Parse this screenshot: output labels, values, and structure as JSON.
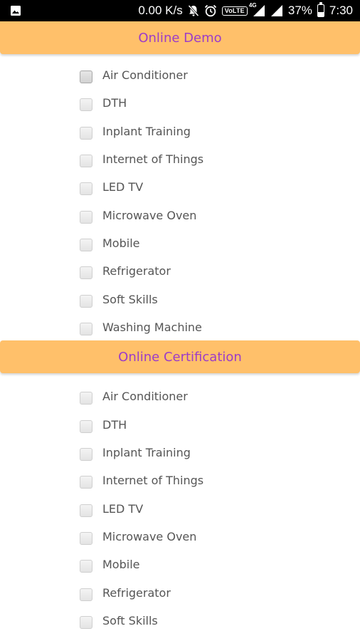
{
  "status_bar": {
    "network_speed": "0.00 K/s",
    "volte_label": "VoLTE",
    "network_type": "4G",
    "battery_percent": "37%",
    "battery_level": 0.37,
    "time": "7:30",
    "icons": [
      "image-icon",
      "mute-icon",
      "alarm-icon",
      "volte-icon",
      "signal-icon",
      "signal-icon",
      "battery-icon"
    ]
  },
  "sections": [
    {
      "title": "Online Demo",
      "items": [
        {
          "label": "Air Conditioner",
          "checked": false
        },
        {
          "label": "DTH",
          "checked": false
        },
        {
          "label": "Inplant Training",
          "checked": false
        },
        {
          "label": "Internet of Things",
          "checked": false
        },
        {
          "label": "LED TV",
          "checked": false
        },
        {
          "label": "Microwave Oven",
          "checked": false
        },
        {
          "label": "Mobile",
          "checked": false
        },
        {
          "label": "Refrigerator",
          "checked": false
        },
        {
          "label": "Soft Skills",
          "checked": false
        },
        {
          "label": "Washing Machine",
          "checked": false
        }
      ]
    },
    {
      "title": "Online Certification",
      "items": [
        {
          "label": "Air Conditioner",
          "checked": false
        },
        {
          "label": "DTH",
          "checked": false
        },
        {
          "label": "Inplant Training",
          "checked": false
        },
        {
          "label": "Internet of Things",
          "checked": false
        },
        {
          "label": "LED TV",
          "checked": false
        },
        {
          "label": "Microwave Oven",
          "checked": false
        },
        {
          "label": "Mobile",
          "checked": false
        },
        {
          "label": "Refrigerator",
          "checked": false
        },
        {
          "label": "Soft Skills",
          "checked": false
        }
      ]
    }
  ],
  "colors": {
    "header_background": "#ffc06a",
    "header_text": "#9c3cc8",
    "label_text": "#555555",
    "status_bar": "#000000"
  }
}
